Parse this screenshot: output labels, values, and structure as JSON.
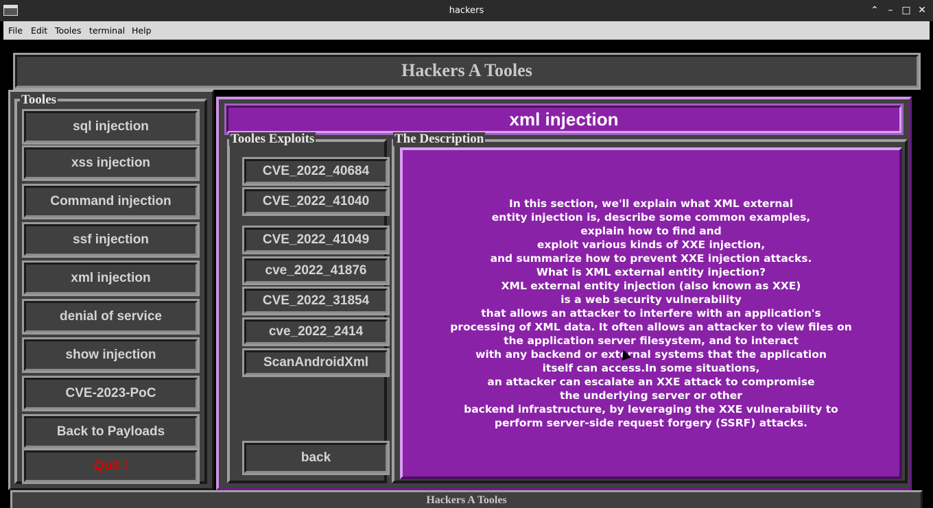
{
  "window": {
    "title": "hackers",
    "controls": [
      "chevron-up-icon",
      "minimize-icon",
      "maximize-icon",
      "close-icon"
    ]
  },
  "menu": [
    "File",
    "Edit",
    "Tooles",
    "terminal",
    "Help"
  ],
  "header": {
    "title": "Hackers A Tooles"
  },
  "left_panel": {
    "legend": "Tooles",
    "buttons": [
      "sql injection",
      "xss injection",
      "Command injection",
      "ssf injection",
      "xml injection",
      "denial of service",
      "show injection",
      "CVE-2023-PoC",
      "Back to Payloads",
      "Quit !"
    ],
    "quit_color": "#e00000"
  },
  "main": {
    "section_title": "xml injection",
    "exploits_legend": "Tooles Exploits",
    "exploits": [
      "CVE_2022_40684",
      "CVE_2022_41040",
      "CVE_2022_41049",
      "cve_2022_41876",
      "CVE_2022_31854",
      "cve_2022_2414",
      "ScanAndroidXml"
    ],
    "back_label": "back",
    "description_legend": "The Description",
    "description": "In this section, we'll explain what XML external\nentity injection is, describe some common examples,\nexplain how to find and\nexploit various kinds of XXE injection,\nand summarize how to prevent XXE injection attacks.\nWhat is XML external entity injection?\nXML external entity injection (also known as XXE)\nis a web security vulnerability\nthat allows an attacker to interfere with an application's\nprocessing of XML data. It often allows an attacker to view files on\nthe application server filesystem, and to interact\nwith any backend or external systems that the application\nitself can access.In some situations,\nan attacker can escalate an XXE attack to compromise\nthe underlying server or other\nbackend infrastructure, by leveraging the XXE vulnerability to\nperform server-side request forgery (SSRF) attacks."
  },
  "footer": {
    "text": "Hackers A Tooles"
  },
  "colors": {
    "panel": "#404040",
    "accent_purple": "#8a22a8",
    "border_purple": "#d090e8"
  }
}
